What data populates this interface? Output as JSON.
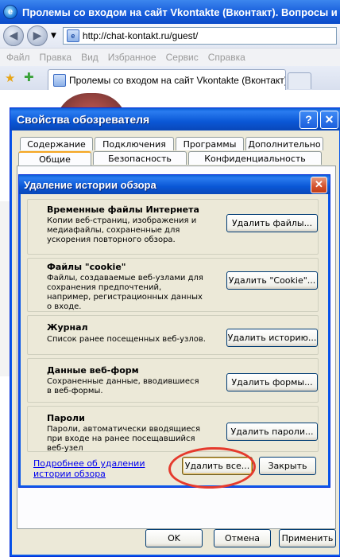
{
  "browser": {
    "window_title": "Пролемы со входом на сайт Vkontakte (Вконтакт). Вопросы и отв",
    "address": "http://chat-kontakt.ru/guest/",
    "menu": [
      "Файл",
      "Правка",
      "Вид",
      "Избранное",
      "Сервис",
      "Справка"
    ],
    "tab_title": "Пролемы со входом на сайт Vkontakte (Вконтакт). ..."
  },
  "options_dialog": {
    "title": "Свойства обозревателя",
    "help_glyph": "?",
    "close_glyph": "✕",
    "tabs_top": [
      "Содержание",
      "Подключения",
      "Программы",
      "Дополнительно"
    ],
    "tabs_bottom": [
      "Общие",
      "Безопасность",
      "Конфиденциальность"
    ],
    "ok_label": "OK",
    "cancel_label": "Отмена",
    "apply_label": "Применить"
  },
  "delete_dialog": {
    "title": "Удаление истории обзора",
    "close_glyph": "✕",
    "sections": [
      {
        "title": "Временные файлы Интернета",
        "desc": "Копии веб-страниц, изображения и медиафайлы, сохраненные для ускорения повторного обзора.",
        "button": "Удалить файлы..."
      },
      {
        "title": "Файлы \"cookie\"",
        "desc": "Файлы, создаваемые веб-узлами для сохранения предпочтений, например, регистрационных данных о входе.",
        "button": "Удалить \"Cookie\"..."
      },
      {
        "title": "Журнал",
        "desc": "Список ранее посещенных веб-узлов.",
        "button": "Удалить историю..."
      },
      {
        "title": "Данные веб-форм",
        "desc": "Сохраненные данные, вводившиеся в веб-формы.",
        "button": "Удалить формы..."
      },
      {
        "title": "Пароли",
        "desc": "Пароли, автоматически вводящиеся при входе на ранее посещавшийся веб-узел",
        "button": "Удалить пароли..."
      }
    ],
    "more_link": "Подробнее об удалении истории обзора",
    "delete_all_label": "Удалить все...",
    "close_label": "Закрыть"
  },
  "colors": {
    "xp_title_blue": "#0a57d6",
    "dialog_face": "#ece9d8",
    "annotation_red": "#e53a2d",
    "link_blue": "#0000ee"
  }
}
